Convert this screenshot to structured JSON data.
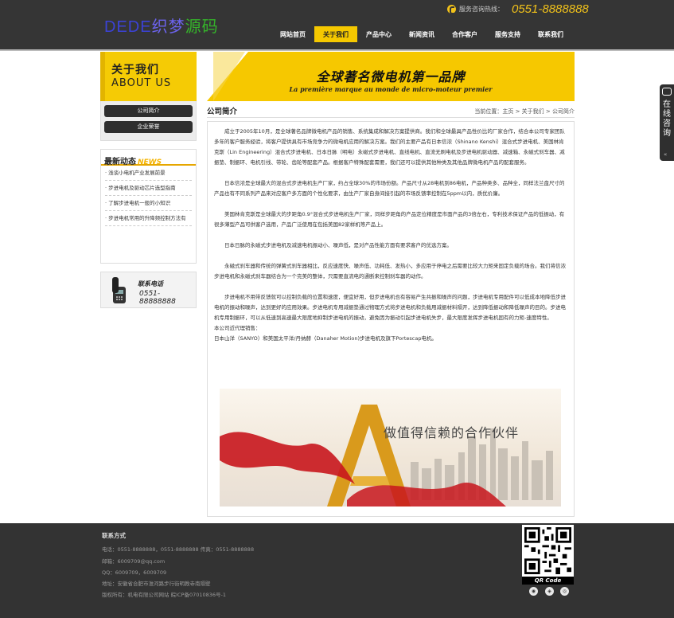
{
  "header": {
    "logo_part1": "DEDE",
    "logo_part2": "织梦",
    "logo_part3": "源码",
    "hotline_label": "服务咨询热线：",
    "hotline_number": "0551-8888888",
    "nav": [
      {
        "label": "网站首页"
      },
      {
        "label": "关于我们",
        "active": true
      },
      {
        "label": "产品中心"
      },
      {
        "label": "新闻资讯"
      },
      {
        "label": "合作客户"
      },
      {
        "label": "服务支持"
      },
      {
        "label": "联系我们"
      }
    ]
  },
  "sidebar": {
    "about_cn": "关于我们",
    "about_en": "ABOUT US",
    "submenu": [
      {
        "label": "公司简介"
      },
      {
        "label": "企业荣誉"
      }
    ],
    "news_title_cn": "最新动态",
    "news_title_en": "NEWS",
    "news": [
      "浅谈小电机产业发展前景",
      "步进电机及驱动芯片选型指南",
      "了解步进电机一般的小知识",
      "步进电机常用的升降频控制方法有"
    ],
    "contact_title": "联系电话",
    "contact_number": "0551-88888888"
  },
  "banner": {
    "title_cn": "全球著名微电机第一品牌",
    "subtitle_fr": "La première marque au monde de micro-moteur premier"
  },
  "content": {
    "title": "公司简介",
    "breadcrumb": "当前位置：主页 > 关于我们 > 公司简介",
    "paragraphs": [
      "成立于2005年10月，是全球著名品牌微电机产品的销售、系统集成和解决方案提供商。我们和全球最具产品性价比的厂家合作，结合本公司专家团队多年的客户服务经验，将客户提供具有市场竞争力的微电机应用的解决方案。我们的主要产品有日本信浓（Shinano Kenshi）混合式步进电机、美国林肯克斯（Lin Engineering）混合式步进电机、日本日脉（明电）永磁式步进电机、直线电机、直流无刷电机及步进电机驱动器、减速箱、永磁式刹车器、减振垫、制振环、电机引线、带轮、齿轮等配套产品。根据客户特殊配套需要，我们还可以提供其他种类及其他品牌微电机产品的配套服务。",
      "日本信浓是全球最大的混合式步进电机生产厂家，约占全球30%的市场份额。产品尺寸从28电机到86电机，产品种类多、品种全，同样法兰盘尺寸的产品也有不同系列产品来对应客户多方面的个性化要求，由生产厂家自身间接引起的市场反馈率控制在5ppm以内，质优价廉。",
      "美国林肯克斯是全球最大的步距角0.9°混合式步进电机生产厂家，同样步距角的产品定位精度是市面产品的3倍左右，专利技术保证产品的低振动，有很多薄型产品可供客户选用，产品广泛使用在包括美国82家样机等产品上。",
      "日本日脉的永磁式步进电机及减速电机振动小、噪声低，是对产品性能方面有要求客户的优选方案。",
      "永磁式刹车器和传统的弹簧式刹车器相比，反应速度快、噪声低、功耗低、发热小，多应用于停电之后需要比较大力矩来固定负载的场合。我们将信浓步进电机和永磁式刹车器结合为一个完美的整体，只需要直流电的通断来控制刹车器的动作。",
      "步进电机不用带反馈就可以控制负载的位置和速度，便宜好用，但步进电机也有容易产生共振和噪声的问题，步进电机专用配件可以低成本地降低步进电机的振动和噪声，达到更好的应用效果。步进电机专用减振垫通过物理方式将步进电机和负载用减振材料隔开，达到降低振动和降低噪声的目的。步进电机专用制振环，可以从低速到高速最大限度地抑制步进电机的振动，避免因为振动引起步进电机失步，最大限度发挥步进电机固有的力矩-速度特性。",
      "本公司近代理销售：",
      "日本山洋（SANYO）和美国太平洋/丹纳赫（Danaher Motion)步进电机及旗下Portescap电机。"
    ],
    "partner_caption": "做值得信赖的合作伙伴"
  },
  "footer": {
    "title": "联系方式",
    "phone": "电话：0551-8888888，0551-8888888  传真：0551-8888888",
    "email": "邮箱：6009709@qq.com",
    "qq": "QQ：6009709，6009709",
    "address": "地址：安徽省合肥市淮河路步行街明教寺南隔壁",
    "copyright": "版权所有：机电有限公司网站 皖ICP备07010836号-1",
    "qr_label": "QR Code"
  },
  "side_float": {
    "label": "在线咨询"
  },
  "colors": {
    "accent_yellow": "#f5c800",
    "header_bg": "#353535",
    "footer_bg": "#333333"
  }
}
